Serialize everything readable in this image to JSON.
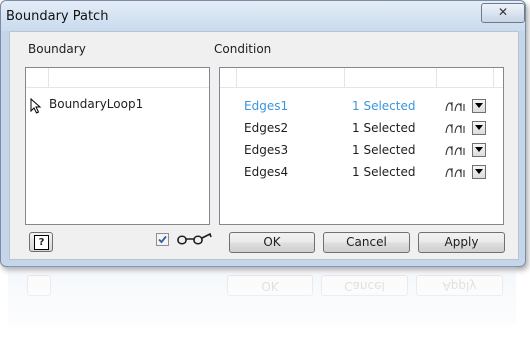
{
  "window": {
    "title": "Boundary Patch",
    "close_glyph": "✕"
  },
  "boundary": {
    "label": "Boundary",
    "items": [
      {
        "label": "BoundaryLoop1"
      }
    ]
  },
  "condition": {
    "label": "Condition",
    "rows": [
      {
        "name": "Edges1",
        "status": "1 Selected",
        "active": true
      },
      {
        "name": "Edges2",
        "status": "1 Selected",
        "active": false
      },
      {
        "name": "Edges3",
        "status": "1 Selected",
        "active": false
      },
      {
        "name": "Edges4",
        "status": "1 Selected",
        "active": false
      }
    ]
  },
  "footer": {
    "help_glyph": "?",
    "preview_checked": true,
    "ok_label": "OK",
    "cancel_label": "Cancel",
    "apply_label": "Apply"
  },
  "colors": {
    "active_row": "#3a96dd",
    "title_bar": "#c9dbee",
    "client_bg": "#f0f0f0"
  },
  "icons": {
    "cursor": "arrow-cursor-icon",
    "condition_type": "tangent-condition-icon",
    "preview": "glasses-icon",
    "help": "help-icon",
    "close": "close-icon"
  }
}
